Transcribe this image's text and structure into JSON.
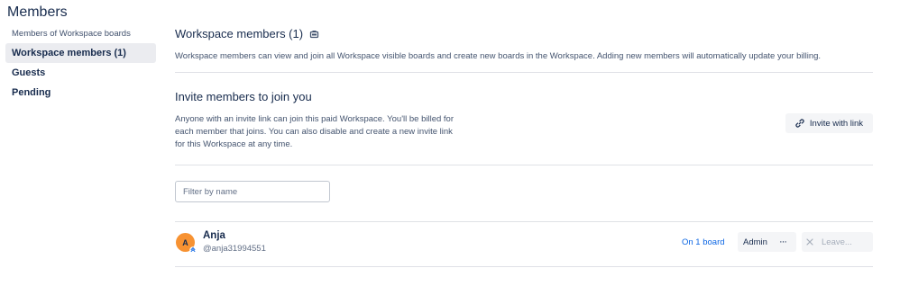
{
  "page": {
    "title": "Members"
  },
  "sidebar": {
    "items": [
      {
        "label": "Members of Workspace boards"
      },
      {
        "label": "Workspace members (1)"
      },
      {
        "label": "Guests"
      },
      {
        "label": "Pending"
      }
    ]
  },
  "workspace": {
    "heading": "Workspace members (1)",
    "description": "Workspace members can view and join all Workspace visible boards and create new boards in the Workspace. Adding new members will automatically update your billing."
  },
  "invite": {
    "title": "Invite members to join you",
    "description": "Anyone with an invite link can join this paid Workspace. You'll be billed for each member that joins. You can also disable and create a new invite link for this Workspace at any time.",
    "button_label": "Invite with link"
  },
  "filter": {
    "placeholder": "Filter by name",
    "value": ""
  },
  "members": [
    {
      "initial": "A",
      "name": "Anja",
      "handle": "@anja31994551",
      "boards_label": "On 1 board",
      "role_label": "Admin",
      "more_label": "···",
      "leave_label": "Leave..."
    }
  ],
  "colors": {
    "avatar": "#f79232",
    "link": "#0c66e4",
    "divider": "#dfe1e6",
    "button_bg": "#f4f5f7",
    "active_bg": "#ebecf0"
  },
  "icons": {
    "workspace_badge": "workspace-badge-icon",
    "invite_link": "link-icon",
    "leave": "close-icon",
    "admin_badge": "admin-badge-icon"
  }
}
